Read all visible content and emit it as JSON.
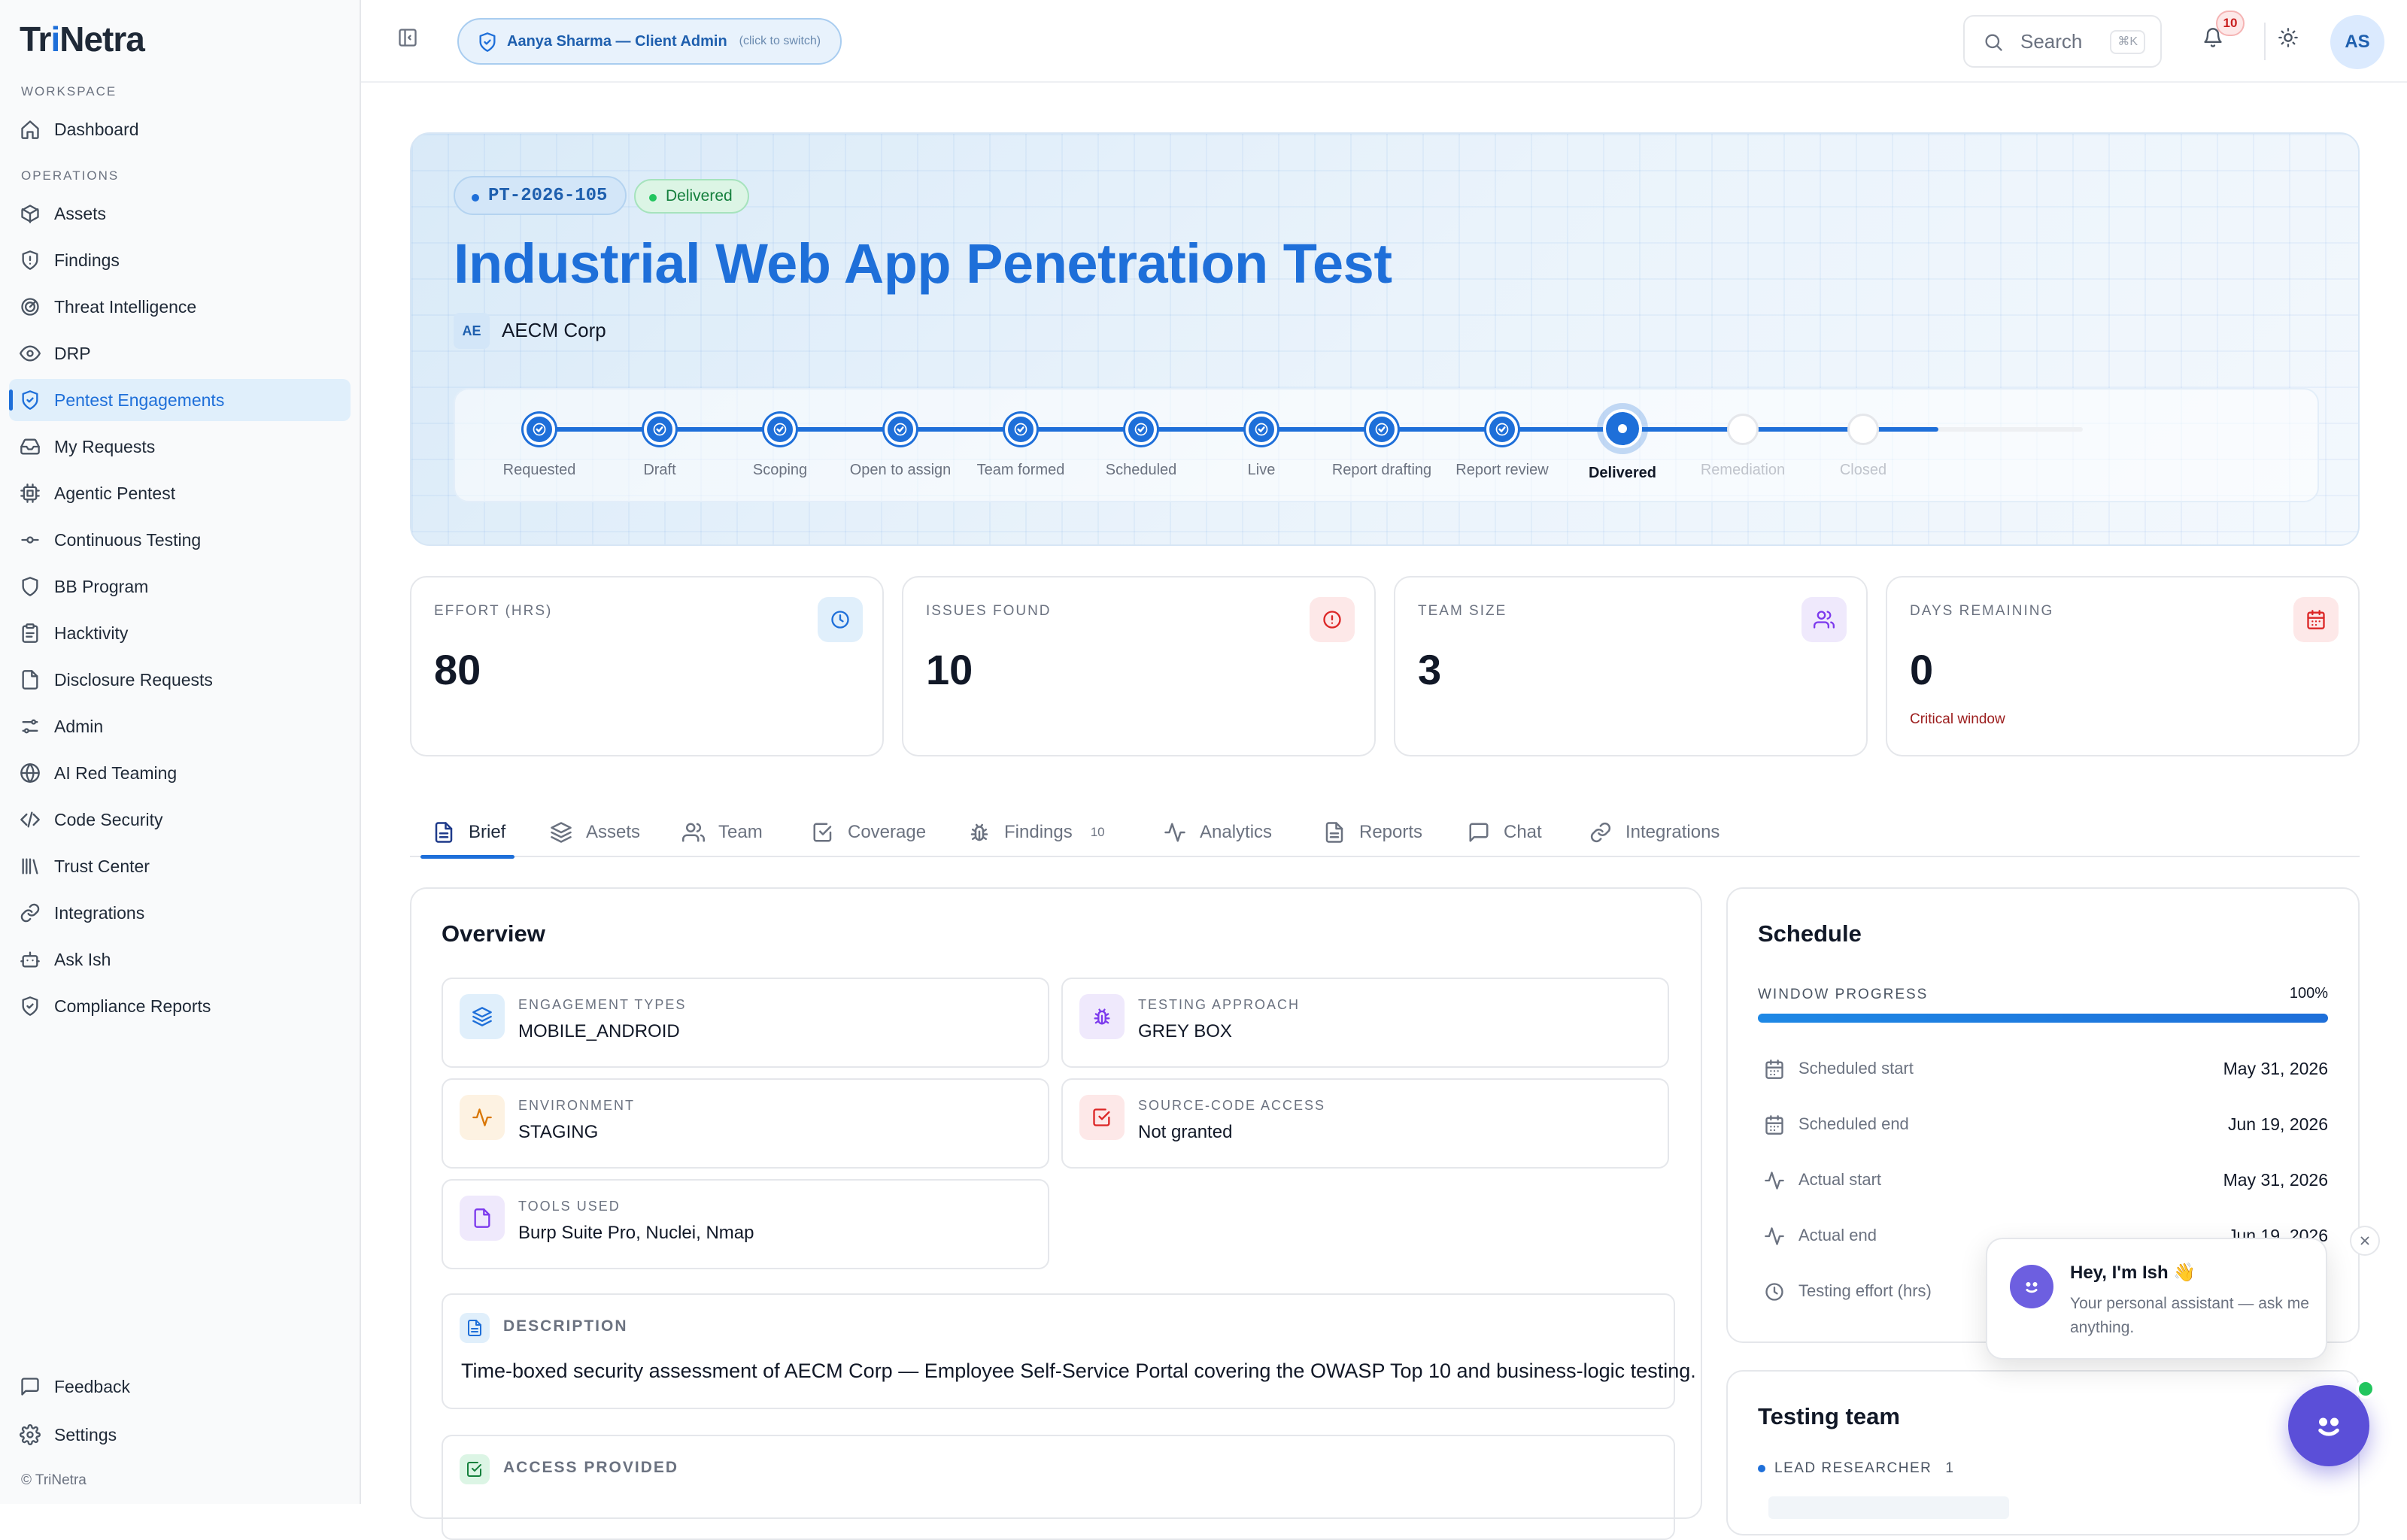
{
  "app": {
    "logo_prefix": "Tr",
    "logo_accent": "i",
    "logo_suffix": "Netra",
    "copyright": "© TriNetra",
    "accent": "#1e6fd9"
  },
  "sidebar": {
    "workspace_label": "WORKSPACE",
    "dashboard": "Dashboard",
    "operations_label": "OPERATIONS",
    "items": [
      {
        "label": "Assets",
        "icon": "box-icon"
      },
      {
        "label": "Findings",
        "icon": "shield-alert-icon"
      },
      {
        "label": "Threat Intelligence",
        "icon": "radar-icon"
      },
      {
        "label": "DRP",
        "icon": "eye-icon"
      },
      {
        "label": "Pentest Engagements",
        "icon": "shield-check-icon",
        "active": true
      },
      {
        "label": "My Requests",
        "icon": "inbox-icon"
      },
      {
        "label": "Agentic Pentest",
        "icon": "cpu-icon"
      },
      {
        "label": "Continuous Testing",
        "icon": "git-commit-icon"
      },
      {
        "label": "BB Program",
        "icon": "shield-icon"
      },
      {
        "label": "Hacktivity",
        "icon": "clipboard-icon"
      },
      {
        "label": "Disclosure Requests",
        "icon": "file-icon"
      },
      {
        "label": "Admin",
        "icon": "sliders-icon"
      },
      {
        "label": "AI Red Teaming",
        "icon": "globe-icon"
      },
      {
        "label": "Code Security",
        "icon": "code-icon"
      },
      {
        "label": "Trust Center",
        "icon": "library-icon"
      },
      {
        "label": "Integrations",
        "icon": "link-icon"
      },
      {
        "label": "Ask Ish",
        "icon": "bot-icon"
      },
      {
        "label": "Compliance Reports",
        "icon": "shield-check-icon"
      }
    ],
    "feedback": "Feedback",
    "settings": "Settings"
  },
  "topbar": {
    "user_pill": "Aanya Sharma — Client Admin",
    "user_pill_hint": "(click to switch)",
    "search_placeholder": "Search",
    "search_shortcut": "⌘K",
    "notifications_count": "10",
    "avatar_initials": "AS"
  },
  "engagement": {
    "id": "PT-2026-105",
    "status": "Delivered",
    "title": "Industrial Web App Penetration Test",
    "client_initials": "AE",
    "client_name": "AECM Corp"
  },
  "stepper": {
    "current_index": 9,
    "steps": [
      "Requested",
      "Draft",
      "Scoping",
      "Open to assign",
      "Team formed",
      "Scheduled",
      "Live",
      "Report drafting",
      "Report review",
      "Delivered",
      "Remediation",
      "Closed"
    ]
  },
  "stats": [
    {
      "label": "EFFORT (HRS)",
      "value": "80",
      "icon": "clock-icon",
      "color": "#1e6fd9",
      "bg": "#e0effb"
    },
    {
      "label": "ISSUES FOUND",
      "value": "10",
      "icon": "alert-circle-icon",
      "color": "#dc2626",
      "bg": "#fde8e8"
    },
    {
      "label": "TEAM SIZE",
      "value": "3",
      "icon": "users-icon",
      "color": "#7c3aed",
      "bg": "#efe9fc"
    },
    {
      "label": "DAYS REMAINING",
      "value": "0",
      "icon": "calendar-icon",
      "color": "#dc2626",
      "bg": "#fde8e8",
      "sub": "Critical window"
    }
  ],
  "tabs": [
    {
      "label": "Brief",
      "icon": "file-text-icon",
      "active": true
    },
    {
      "label": "Assets",
      "icon": "layers-icon"
    },
    {
      "label": "Team",
      "icon": "users-icon"
    },
    {
      "label": "Coverage",
      "icon": "check-square-icon"
    },
    {
      "label": "Findings",
      "icon": "bug-icon",
      "count": "10"
    },
    {
      "label": "Analytics",
      "icon": "activity-icon"
    },
    {
      "label": "Reports",
      "icon": "file-text-icon"
    },
    {
      "label": "Chat",
      "icon": "message-square-icon"
    },
    {
      "label": "Integrations",
      "icon": "link-icon"
    }
  ],
  "overview": {
    "title": "Overview",
    "fields": [
      {
        "label": "ENGAGEMENT TYPES",
        "value": "MOBILE_ANDROID",
        "icon": "layers-icon",
        "color": "#1e6fd9",
        "bg": "#e0effb"
      },
      {
        "label": "TESTING APPROACH",
        "value": "GREY BOX",
        "icon": "bug-icon",
        "color": "#7c3aed",
        "bg": "#efe9fc"
      },
      {
        "label": "ENVIRONMENT",
        "value": "STAGING",
        "icon": "activity-icon",
        "color": "#d97706",
        "bg": "#fdf2e2"
      },
      {
        "label": "SOURCE-CODE ACCESS",
        "value": "Not granted",
        "icon": "check-square-icon",
        "color": "#dc2626",
        "bg": "#fde8e8"
      },
      {
        "label": "TOOLS USED",
        "value": "Burp Suite Pro, Nuclei, Nmap",
        "icon": "file-icon",
        "color": "#7c3aed",
        "bg": "#efe9fc"
      }
    ],
    "description_label": "DESCRIPTION",
    "description": "Time-boxed security assessment of AECM Corp — Employee Self-Service Portal covering the OWASP Top 10 and business-logic testing.",
    "access_label": "ACCESS PROVIDED"
  },
  "schedule": {
    "title": "Schedule",
    "progress_label": "WINDOW PROGRESS",
    "progress_text": "100%",
    "progress_value": 1.0,
    "rows": [
      {
        "label": "Scheduled start",
        "value": "May 31, 2026",
        "icon": "calendar-icon"
      },
      {
        "label": "Scheduled end",
        "value": "Jun 19, 2026",
        "icon": "calendar-icon"
      },
      {
        "label": "Actual start",
        "value": "May 31, 2026",
        "icon": "activity-icon"
      },
      {
        "label": "Actual end",
        "value": "Jun 19, 2026",
        "icon": "activity-icon"
      },
      {
        "label": "Testing effort (hrs)",
        "value": "",
        "icon": "clock-icon"
      }
    ]
  },
  "team": {
    "title": "Testing team",
    "lead_label": "LEAD RESEARCHER",
    "lead_count": "1"
  },
  "assistant": {
    "greeting": "Hey, I'm Ish 👋",
    "subtitle": "Your personal assistant — ask me anything."
  }
}
